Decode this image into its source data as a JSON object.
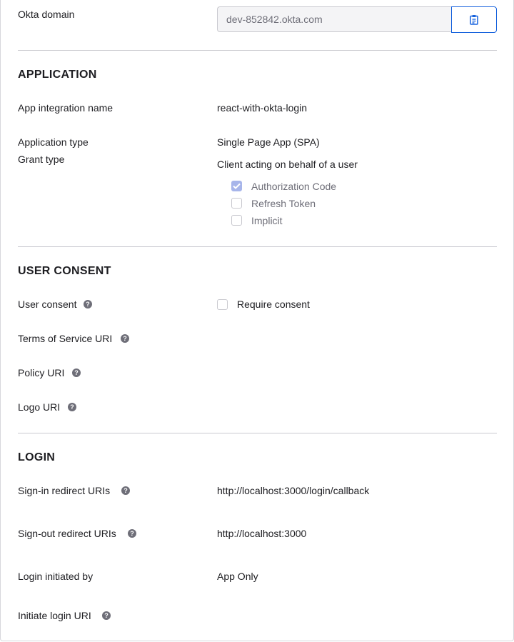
{
  "okta_domain": {
    "label": "Okta domain",
    "value": "dev-852842.okta.com",
    "copy_icon": "clipboard-icon"
  },
  "application": {
    "title": "APPLICATION",
    "integration_name_label": "App integration name",
    "integration_name_value": "react-with-okta-login",
    "app_type_label": "Application type",
    "app_type_value": "Single Page App (SPA)",
    "grant_type_label": "Grant type",
    "grant_type_desc": "Client acting on behalf of a user",
    "grants": [
      {
        "label": "Authorization Code",
        "checked": true
      },
      {
        "label": "Refresh Token",
        "checked": false
      },
      {
        "label": "Implicit",
        "checked": false
      }
    ]
  },
  "user_consent": {
    "title": "USER CONSENT",
    "consent_label": "User consent",
    "require_consent_label": "Require consent",
    "tos_label": "Terms of Service URI",
    "policy_label": "Policy URI",
    "logo_label": "Logo URI",
    "help_glyph": "?"
  },
  "login": {
    "title": "LOGIN",
    "signin_label": "Sign-in redirect URIs",
    "signin_value": "http://localhost:3000/login/callback",
    "signout_label": "Sign-out redirect URIs",
    "signout_value": "http://localhost:3000",
    "initiated_by_label": "Login initiated by",
    "initiated_by_value": "App Only",
    "initiate_uri_label": "Initiate login URI"
  },
  "colors": {
    "accent": "#1662dd",
    "checked_fill": "#a7b5ea",
    "help_icon": "#6e6e78"
  }
}
